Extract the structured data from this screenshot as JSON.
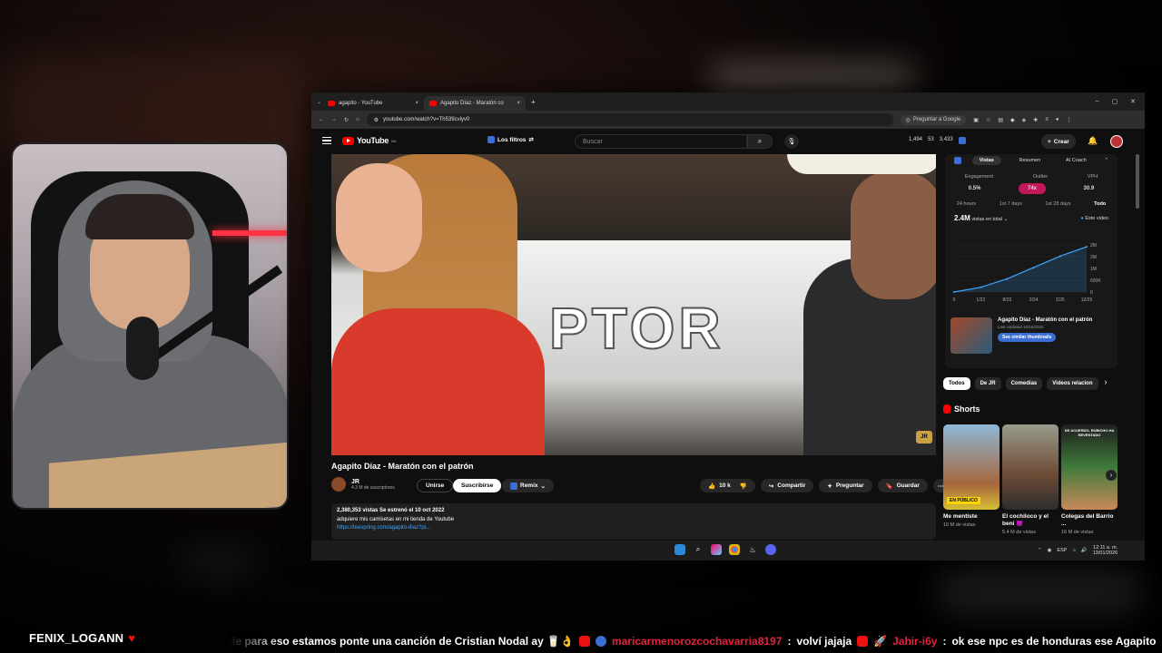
{
  "browser": {
    "tabs": [
      {
        "title": "agapito - YouTube",
        "close": "×"
      },
      {
        "title": "Agapito Díaz - Maratón co",
        "close": "×"
      }
    ],
    "new_tab": "+",
    "window_controls": {
      "minimize": "–",
      "maximize": "▢",
      "close": "✕"
    },
    "url": "youtube.com/watch?v=Th539cvlyv0",
    "google_btn": "Preguntar a Google"
  },
  "youtube": {
    "logo": "YouTube",
    "region": "MX",
    "filters": "Los filtros",
    "search_placeholder": "Buscar",
    "stats": [
      "1,494",
      "53",
      "3,433"
    ],
    "create": "Crear",
    "video": {
      "title": "Agapito Díaz - Maratón con el patrón",
      "badge": "JR",
      "channel": "JR",
      "subscribers": "4.3 M de suscriptores",
      "join": "Unirse",
      "subscribe": "Suscribirse",
      "remix": "Remix",
      "likes": "10 k",
      "share": "Compartir",
      "ask": "Preguntar",
      "save": "Guardar",
      "more": "⋯",
      "views_line": "2,380,353 vistas  Se estrenó el 10 oct 2022",
      "desc_line": "adquiere mis camisetas en mi tienda de Youtube",
      "desc_link": "https://teespring.com/agapito-diaz?pi..."
    },
    "panel": {
      "tabs": [
        "Vistas",
        "Resumen",
        "AI Coach"
      ],
      "metrics": [
        "Engagement",
        "Outlier",
        "VPH"
      ],
      "metric_values": [
        "0.5%",
        "74x",
        "30.9"
      ],
      "periods": [
        "24 hours",
        "1st 7 days",
        "1st 28 days",
        "Todo"
      ],
      "total_views": "2.4M",
      "total_label": "vistas en total",
      "legend": "Este video",
      "thumb_title": "Agapito Díaz - Maratón con el patrón",
      "last_updated": "Last Updated 10/10/2022",
      "similar": "See similar thumbnails"
    },
    "chips": [
      "Todos",
      "De JR",
      "Comedias",
      "Videos relacion"
    ],
    "shorts_title": "Shorts",
    "shorts": [
      {
        "title": "Me mentiste",
        "views": "10 M de vistas",
        "overlay": "EN PÚBLICO"
      },
      {
        "title": "El cochiloco y el beni 😈",
        "views": "5.4 M de vistas",
        "overlay": ""
      },
      {
        "title": "Colegas del Barrio ...",
        "views": "16 M de vistas",
        "overlay": "DE ACUERDO, RUBICHO HA REVENTADO"
      }
    ]
  },
  "chart_data": {
    "type": "line",
    "x": [
      "0",
      "1/23",
      "8/23",
      "2/24",
      "2/25",
      "12/25"
    ],
    "series": [
      {
        "name": "Este video",
        "values": [
          0,
          250000,
          700000,
          1300000,
          1900000,
          2400000
        ]
      }
    ],
    "yticks": [
      "2M",
      "2M",
      "1M",
      "600K",
      "0"
    ],
    "ylim": [
      0,
      2500000
    ]
  },
  "taskbar": {
    "lang": "ESP",
    "time": "12:11 a. m.",
    "date": "13/01/2026"
  },
  "stream": {
    "streamer": "FENIX_LOGANN",
    "chat": [
      {
        "user": "",
        "text": "de para eso estamos  ponte una canción de Cristian Nodal ay 🥛👌"
      },
      {
        "user": "maricarmenorozcochavarria8197",
        "text": "volví jajaja"
      },
      {
        "user": "Jahir-i6y",
        "text": "ok  ese npc es de honduras  ese Agapito"
      }
    ]
  }
}
